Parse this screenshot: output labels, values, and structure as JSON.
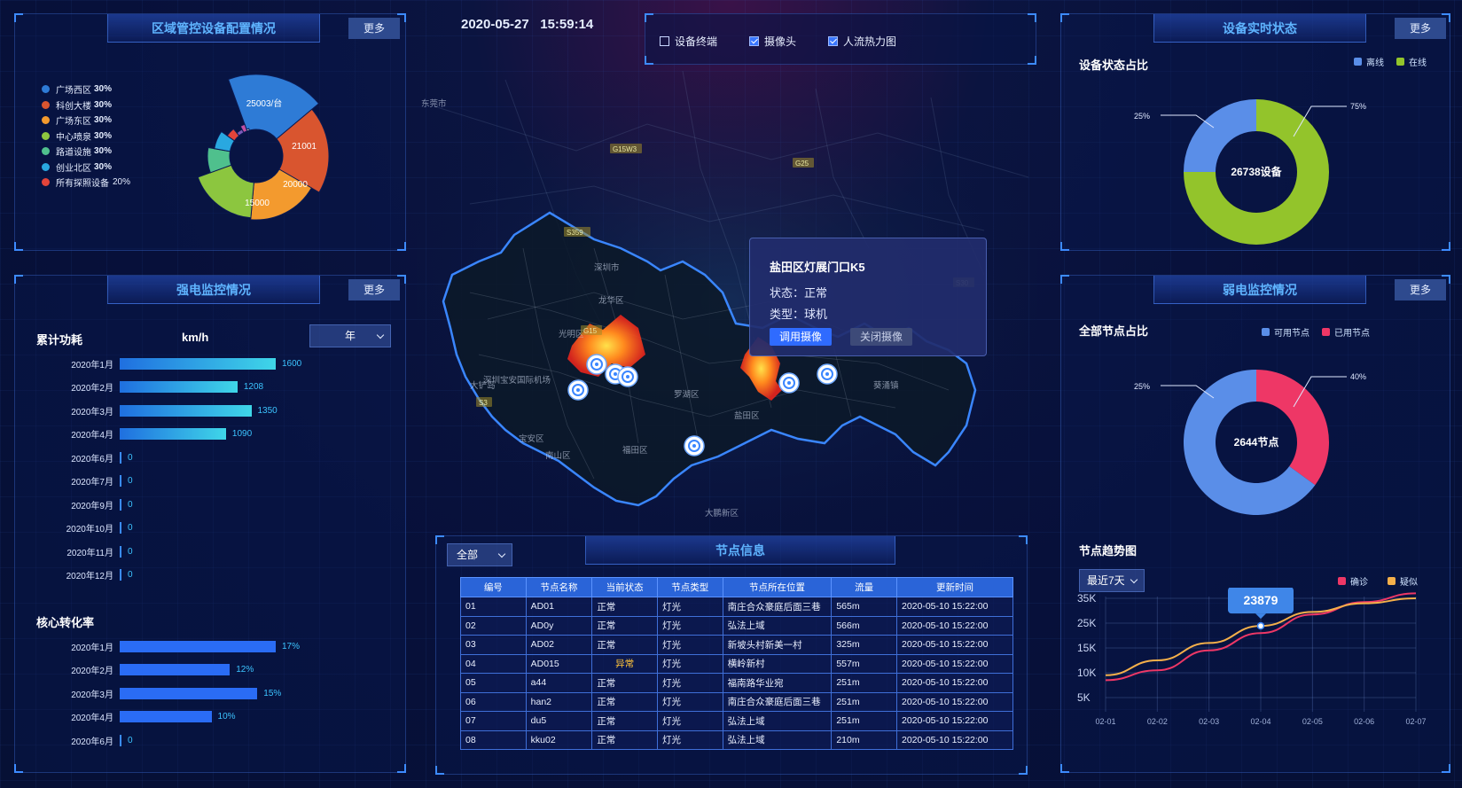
{
  "datetime": "2020-05-27   15:59:14",
  "layers": [
    {
      "label": "设备终端",
      "checked": false
    },
    {
      "label": "摄像头",
      "checked": true
    },
    {
      "label": "人流热力图",
      "checked": true
    }
  ],
  "more_label": "更多",
  "region_panel": {
    "title": "区域管控设备配置情况",
    "legend": [
      {
        "name": "广场西区",
        "pct": "30%",
        "color": "#2e7bd6"
      },
      {
        "name": "科创大楼",
        "pct": "30%",
        "color": "#d9552f"
      },
      {
        "name": "广场东区",
        "pct": "30%",
        "color": "#f39a2e"
      },
      {
        "name": "中心喷泉",
        "pct": "30%",
        "color": "#8cc63f"
      },
      {
        "name": "路道设施",
        "pct": "30%",
        "color": "#4fc08d"
      },
      {
        "name": "创业北区",
        "pct": "30%",
        "color": "#29a8e0"
      },
      {
        "name": "所有探照设备",
        "pct": "20%",
        "color": "#e2443a"
      }
    ],
    "rose_labels": [
      "25003/台",
      "21001",
      "20000",
      "15000"
    ]
  },
  "strong_panel": {
    "title": "强电监控情况",
    "label_power": "累计功耗",
    "unit": "km/h",
    "select_value": "年",
    "bars": [
      {
        "label": "2020年1月",
        "value": "1600",
        "v": 1600
      },
      {
        "label": "2020年2月",
        "value": "1208",
        "v": 1208
      },
      {
        "label": "2020年3月",
        "value": "1350",
        "v": 1350
      },
      {
        "label": "2020年4月",
        "value": "1090",
        "v": 1090
      },
      {
        "label": "2020年6月",
        "value": "0",
        "v": 0
      },
      {
        "label": "2020年7月",
        "value": "0",
        "v": 0
      },
      {
        "label": "2020年9月",
        "value": "0",
        "v": 0
      },
      {
        "label": "2020年10月",
        "value": "0",
        "v": 0
      },
      {
        "label": "2020年11月",
        "value": "0",
        "v": 0
      },
      {
        "label": "2020年12月",
        "value": "0",
        "v": 0
      }
    ],
    "label_conversion": "核心转化率",
    "conv_bars": [
      {
        "label": "2020年1月",
        "value": "17%",
        "v": 17
      },
      {
        "label": "2020年2月",
        "value": "12%",
        "v": 12
      },
      {
        "label": "2020年3月",
        "value": "15%",
        "v": 15
      },
      {
        "label": "2020年4月",
        "value": "10%",
        "v": 10
      },
      {
        "label": "2020年6月",
        "value": "0",
        "v": 0
      }
    ]
  },
  "map": {
    "labels": [
      "东莞市",
      "龙华区",
      "深圳宝安国际机场",
      "宝安区",
      "南山区",
      "福田区",
      "罗湖区",
      "盐田区",
      "大鹏新区",
      "葵涌镇",
      "深圳市",
      "光明区",
      "大铲岛"
    ],
    "road_labels": [
      "G15W3",
      "G25",
      "S359",
      "S30",
      "G15",
      "S3"
    ]
  },
  "popup": {
    "title": "盐田区灯展门口K5",
    "status": "状态：正常",
    "type": "类型：球机",
    "btn_call": "调用摄像",
    "btn_close": "关闭摄像"
  },
  "node_panel": {
    "title": "节点信息",
    "filter": "全部",
    "columns": [
      "编号",
      "节点名称",
      "当前状态",
      "节点类型",
      "节点所在位置",
      "流量",
      "更新时间"
    ],
    "rows": [
      [
        "01",
        "AD01",
        "正常",
        "灯光",
        "南庄合众豪庭后面三巷",
        "565m",
        "2020-05-10 15:22:00"
      ],
      [
        "02",
        "AD0y",
        "正常",
        "灯光",
        "弘法上域",
        "566m",
        "2020-05-10 15:22:00"
      ],
      [
        "03",
        "AD02",
        "正常",
        "灯光",
        "新坡头村新美一村",
        "325m",
        "2020-05-10 15:22:00"
      ],
      [
        "04",
        "AD015",
        "异常",
        "灯光",
        "横岭新村",
        "557m",
        "2020-05-10 15:22:00"
      ],
      [
        "05",
        "a44",
        "正常",
        "灯光",
        "福南路华业宛",
        "251m",
        "2020-05-10 15:22:00"
      ],
      [
        "06",
        "han2",
        "正常",
        "灯光",
        "南庄合众豪庭后面三巷",
        "251m",
        "2020-05-10 15:22:00"
      ],
      [
        "07",
        "du5",
        "正常",
        "灯光",
        "弘法上域",
        "251m",
        "2020-05-10 15:22:00"
      ],
      [
        "08",
        "kku02",
        "正常",
        "灯光",
        "弘法上域",
        "210m",
        "2020-05-10 15:22:00"
      ]
    ]
  },
  "device_status": {
    "title": "设备实时状态",
    "subtitle": "设备状态占比",
    "legend": [
      {
        "name": "离线",
        "color": "#5a8ee8"
      },
      {
        "name": "在线",
        "color": "#93c42b"
      }
    ],
    "center": "26738设备",
    "pct_left": "25%",
    "pct_right": "75%",
    "offline_pct": 25
  },
  "weak_panel": {
    "title": "弱电监控情况",
    "subtitle": "全部节点占比",
    "legend": [
      {
        "name": "可用节点",
        "color": "#5a8ee8"
      },
      {
        "name": "已用节点",
        "color": "#ee3766"
      }
    ],
    "center": "2644节点",
    "pct_left": "25%",
    "pct_right": "40%",
    "used_pct": 35,
    "trend_title": "节点趋势图",
    "range_select": "最近7天",
    "trend_legend": [
      {
        "name": "确诊",
        "color": "#ee3766"
      },
      {
        "name": "疑似",
        "color": "#f5b04a"
      }
    ],
    "tooltip": "23879"
  },
  "chart_data": {
    "type": "line",
    "title": "节点趋势图",
    "x": [
      "02-01",
      "02-02",
      "02-03",
      "02-04",
      "02-05",
      "02-06",
      "02-07"
    ],
    "yticks": [
      "35K",
      "25K",
      "15K",
      "10K",
      "5K"
    ],
    "ylim": [
      5000,
      37000
    ],
    "series": [
      {
        "name": "确诊",
        "values": [
          8500,
          10500,
          14500,
          21000,
          28500,
          33500,
          37000
        ]
      },
      {
        "name": "疑似",
        "values": [
          9500,
          12500,
          17000,
          23879,
          29500,
          33000,
          35000
        ]
      }
    ]
  }
}
